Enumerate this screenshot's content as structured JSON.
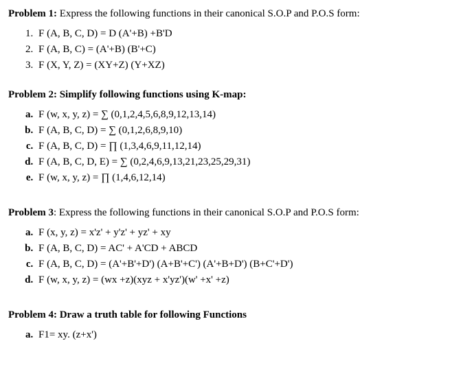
{
  "problem1": {
    "title": "Problem 1:",
    "desc": " Express the following functions in their canonical S.O.P and P.O.S form:",
    "items": [
      "F (A, B, C, D) = D (A'+B) +B'D",
      "F (A, B, C) = (A'+B) (B'+C)",
      "F (X, Y, Z) = (XY+Z) (Y+XZ)"
    ]
  },
  "problem2": {
    "title": "Problem 2:",
    "desc": " Simplify following functions using K-map:",
    "items": [
      "F (w, x, y, z) = ∑ (0,1,2,4,5,6,8,9,12,13,14)",
      "F (A, B, C, D) = ∑ (0,1,2,6,8,9,10)",
      "F (A, B, C, D) = ∏ (1,3,4,6,9,11,12,14)",
      "F (A, B, C, D, E) = ∑ (0,2,4,6,9,13,21,23,25,29,31)",
      "F (w, x, y, z) = ∏ (1,4,6,12,14)"
    ]
  },
  "problem3": {
    "title": "Problem 3",
    "desc": ": Express the following functions in their canonical S.O.P and P.O.S form:",
    "items": [
      "F (x, y, z) = x'z' + y'z' + yz' + xy",
      "F (A, B, C, D) = AC' + A'CD + ABCD",
      "F (A, B, C, D) = (A'+B'+D') (A+B'+C') (A'+B+D') (B+C'+D')",
      "F (w, x, y, z) = (wx +z)(xyz + x'yz')(w' +x' +z)"
    ]
  },
  "problem4": {
    "title": "Problem 4:",
    "desc": " Draw a truth table for following Functions",
    "items": [
      "F1= xy. (z+x')"
    ]
  }
}
